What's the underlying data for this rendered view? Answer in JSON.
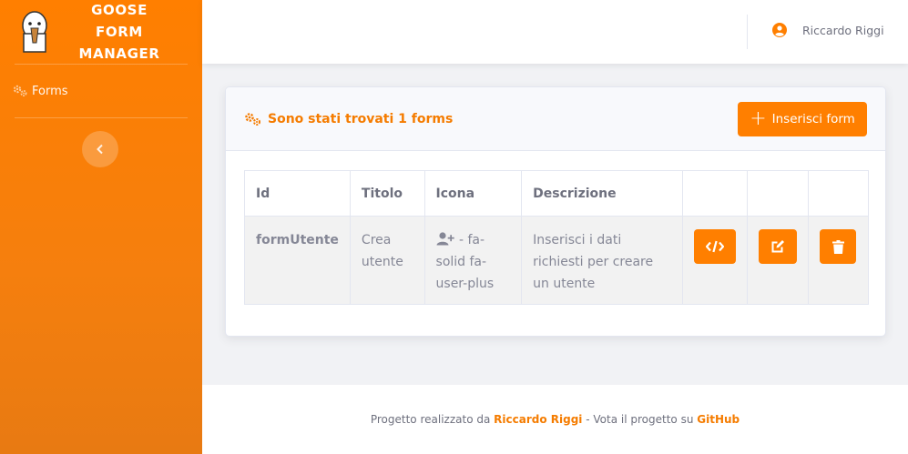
{
  "brand": {
    "line1": "GOOSE FORM",
    "line2": "MANAGER"
  },
  "sidebar": {
    "nav": [
      {
        "label": "Forms",
        "icon": "gears-icon"
      }
    ],
    "toggle_icon": "chevron-left-icon"
  },
  "topbar": {
    "user_name": "Riccardo Riggi",
    "user_icon": "user-circle-icon"
  },
  "card": {
    "title": "Sono stati trovati 1 forms",
    "add_button": "Inserisci form",
    "table": {
      "headers": [
        "Id",
        "Titolo",
        "Icona",
        "Descrizione",
        "",
        "",
        ""
      ],
      "rows": [
        {
          "id": "formUtente",
          "titolo": "Crea utente",
          "icona": "- fa-solid fa-user-plus",
          "icona_glyph": "user-plus-icon",
          "descrizione": "Inserisci i dati richiesti per creare un utente",
          "actions": [
            "code-icon",
            "edit-icon",
            "trash-icon"
          ]
        }
      ]
    }
  },
  "footer": {
    "prefix": "Progetto realizzato da",
    "author": "Riccardo Riggi",
    "middle": "- Vota il progetto su",
    "github": "GitHub"
  },
  "colors": {
    "accent": "#ff7f00",
    "accent_text": "#f57c00"
  }
}
